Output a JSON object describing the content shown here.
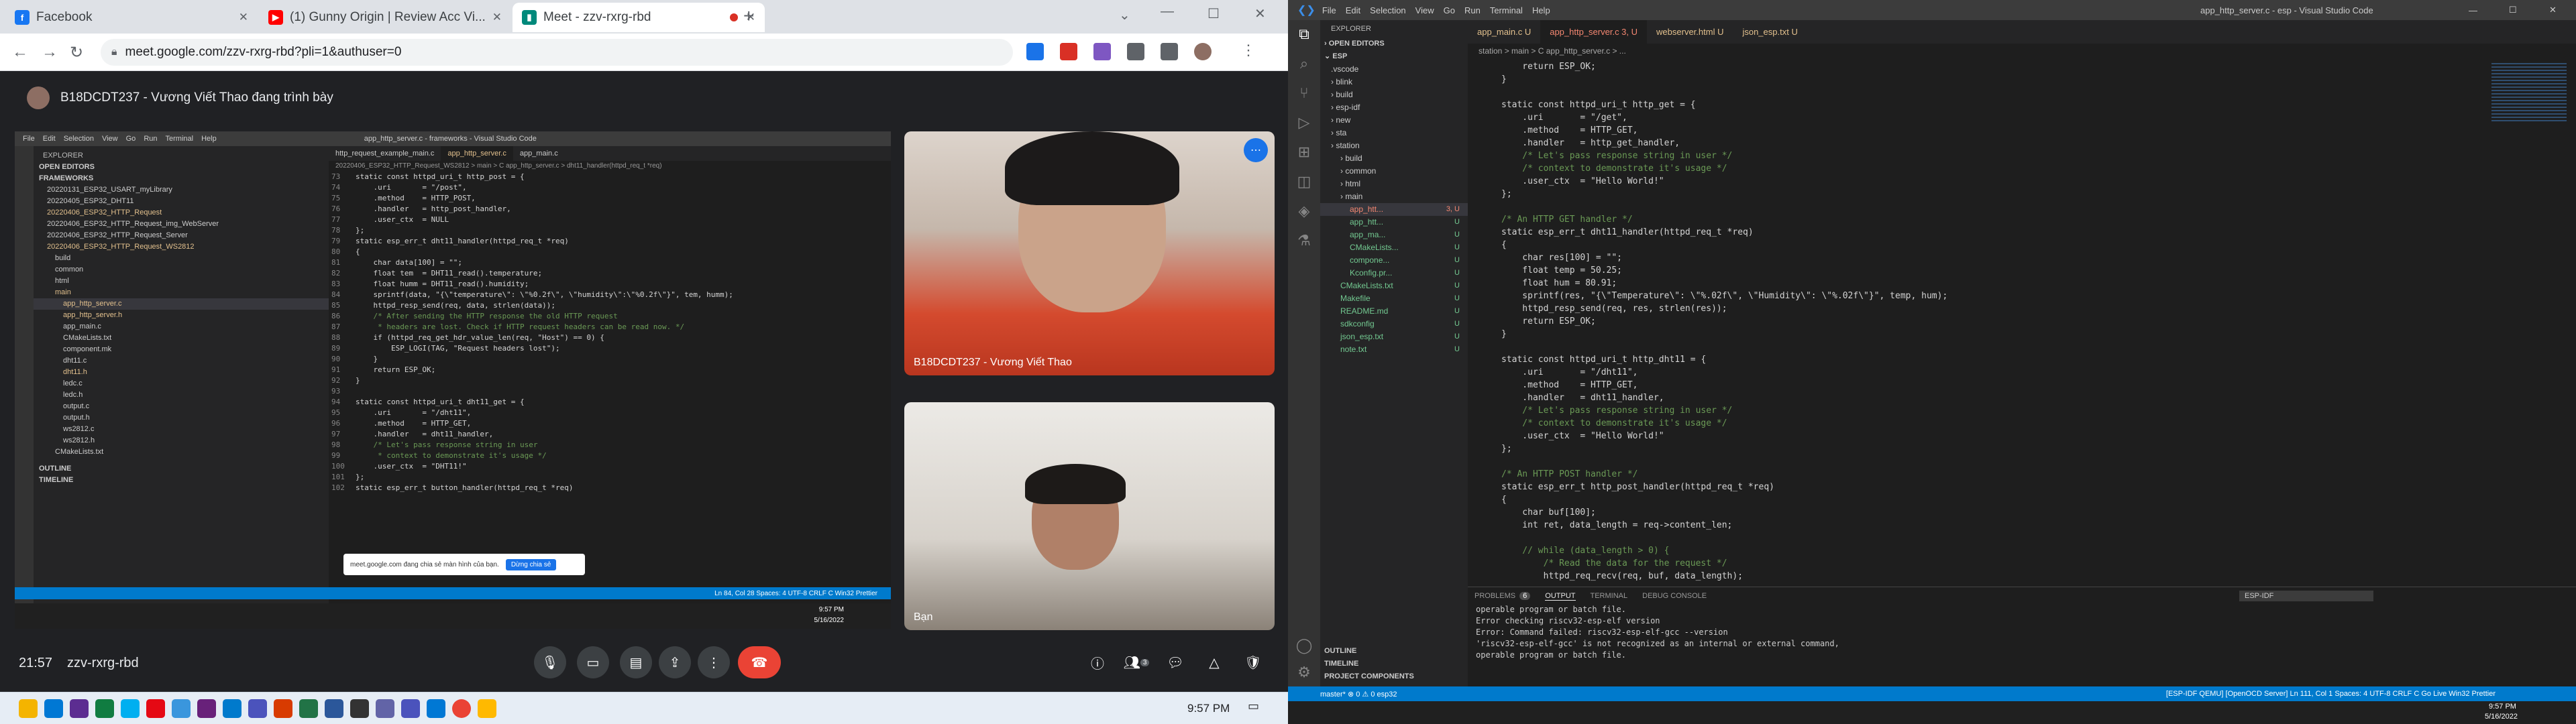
{
  "browser": {
    "tabs": [
      {
        "label": "Facebook",
        "icon": "facebook-icon",
        "color": "#1877f2"
      },
      {
        "label": "(1) Gunny Origin | Review Acc Vi...",
        "icon": "youtube-icon",
        "color": "#ff0000"
      },
      {
        "label": "Meet - zzv-rxrg-rbd",
        "icon": "meet-icon",
        "color": "#00897b"
      }
    ],
    "url": "meet.google.com/zzv-rxrg-rbd?pli=1&authuser=0"
  },
  "meet": {
    "presenter_text": "B18DCDT237 - Vương Viết Thao đang trình bày",
    "participant1": "B18DCDT237 - Vương Viết Thao",
    "participant2": "Bạn",
    "time": "21:57",
    "meeting_code": "zzv-rxrg-rbd",
    "notif_text": "meet.google.com đang chia sẻ màn hình của bạn.",
    "notif_btn": "Dừng chia sẻ",
    "people_count": "3",
    "end_color": "#ea4335"
  },
  "shared": {
    "title": "app_http_server.c - frameworks - Visual Studio Code",
    "menu": [
      "File",
      "Edit",
      "Selection",
      "View",
      "Go",
      "Run",
      "Terminal",
      "Help"
    ],
    "tabs": [
      "http_request_example_main.c",
      "app_http_server.c",
      "app_main.c"
    ],
    "breadcrumb": "20220406_ESP32_HTTP_Request_WS2812 > main > C app_http_server.c > dht11_handler(httpd_req_t *req)",
    "tree": [
      "EXPLORER",
      "OPEN EDITORS",
      "FRAMEWORKS",
      "20220131_ESP32_USART_myLibrary",
      "20220405_ESP32_DHT11",
      "20220406_ESP32_HTTP_Request",
      "20220406_ESP32_HTTP_Request_img_WebServer",
      "20220406_ESP32_HTTP_Request_Server",
      "20220406_ESP32_HTTP_Request_WS2812",
      "build",
      "common",
      "html",
      "main",
      "app_http_server.c",
      "app_http_server.h",
      "app_main.c",
      "CMakeLists.txt",
      "component.mk",
      "dht11.c",
      "dht11.h",
      "ledc.c",
      "ledc.h",
      "output.c",
      "output.h",
      "ws2812.c",
      "ws2812.h",
      "CMakeLists.txt",
      "OUTLINE",
      "TIMELINE"
    ],
    "code": [
      [
        "73",
        "static const httpd_uri_t http_post = {"
      ],
      [
        "74",
        "    .uri       = \"/post\","
      ],
      [
        "75",
        "    .method    = HTTP_POST,"
      ],
      [
        "76",
        "    .handler   = http_post_handler,"
      ],
      [
        "77",
        "    .user_ctx  = NULL"
      ],
      [
        "78",
        "};"
      ],
      [
        "79",
        "static esp_err_t dht11_handler(httpd_req_t *req)"
      ],
      [
        "80",
        "{"
      ],
      [
        "81",
        "    char data[100] = \"\";"
      ],
      [
        "82",
        "    float tem  = DHT11_read().temperature;"
      ],
      [
        "83",
        "    float humm = DHT11_read().humidity;"
      ],
      [
        "84",
        "    sprintf(data, \"{\\\"temperature\\\": \\\"%0.2f\\\", \\\"humidity\\\":\\\"%0.2f\\\"}\", tem, humm);"
      ],
      [
        "85",
        "    httpd_resp_send(req, data, strlen(data));"
      ],
      [
        "86",
        "    /* After sending the HTTP response the old HTTP request"
      ],
      [
        "87",
        "     * headers are lost. Check if HTTP request headers can be read now. */"
      ],
      [
        "88",
        "    if (httpd_req_get_hdr_value_len(req, \"Host\") == 0) {"
      ],
      [
        "89",
        "        ESP_LOGI(TAG, \"Request headers lost\");"
      ],
      [
        "90",
        "    }"
      ],
      [
        "91",
        "    return ESP_OK;"
      ],
      [
        "92",
        "}"
      ],
      [
        "93",
        ""
      ],
      [
        "94",
        "static const httpd_uri_t dht11_get = {"
      ],
      [
        "95",
        "    .uri       = \"/dht11\","
      ],
      [
        "96",
        "    .method    = HTTP_GET,"
      ],
      [
        "97",
        "    .handler   = dht11_handler,"
      ],
      [
        "98",
        "    /* Let's pass response string in user"
      ],
      [
        "99",
        "     * context to demonstrate it's usage */"
      ],
      [
        "100",
        "    .user_ctx  = \"DHT11!\""
      ],
      [
        "101",
        "};"
      ],
      [
        "102",
        "static esp_err_t button_handler(httpd_req_t *req)"
      ]
    ],
    "status": "Ln 84, Col 28   Spaces: 4   UTF-8   CRLF   C   Win32   Prettier",
    "clock": "9:57 PM",
    "date": "5/16/2022"
  },
  "vscode": {
    "title": "app_http_server.c - esp - Visual Studio Code",
    "menu": [
      "File",
      "Edit",
      "Selection",
      "View",
      "Go",
      "Run",
      "Terminal",
      "Help"
    ],
    "tabs": [
      "app_main.c  U",
      "app_http_server.c  3, U",
      "webserver.html  U",
      "json_esp.txt  U"
    ],
    "breadcrumb": "station > main > C app_http_server.c > ...",
    "explorer": {
      "header": "EXPLORER",
      "open_editors": "OPEN EDITORS",
      "root": "ESP",
      "items": [
        {
          "label": ".vscode",
          "mod": ""
        },
        {
          "label": "blink",
          "mod": ""
        },
        {
          "label": "build",
          "mod": ""
        },
        {
          "label": "esp-idf",
          "mod": ""
        },
        {
          "label": "new",
          "mod": ""
        },
        {
          "label": "sta",
          "mod": ""
        },
        {
          "label": "station",
          "mod": ""
        },
        {
          "label": "build",
          "mod": ""
        },
        {
          "label": "common",
          "mod": ""
        },
        {
          "label": "html",
          "mod": ""
        },
        {
          "label": "main",
          "mod": ""
        },
        {
          "label": "app_htt...",
          "mod": "3, U"
        },
        {
          "label": "app_htt...",
          "mod": "U"
        },
        {
          "label": "app_ma...",
          "mod": "U"
        },
        {
          "label": "CMakeLists...",
          "mod": "U"
        },
        {
          "label": "compone...",
          "mod": "U"
        },
        {
          "label": "Kconfig.pr...",
          "mod": "U"
        },
        {
          "label": "CMakeLists.txt",
          "mod": "U"
        },
        {
          "label": "Makefile",
          "mod": "U"
        },
        {
          "label": "README.md",
          "mod": "U"
        },
        {
          "label": "sdkconfig",
          "mod": "U"
        },
        {
          "label": "json_esp.txt",
          "mod": "U"
        },
        {
          "label": "note.txt",
          "mod": "U"
        }
      ],
      "outline": "OUTLINE",
      "timeline": "TIMELINE",
      "project": "PROJECT COMPONENTS"
    },
    "code": [
      "    return ESP_OK;",
      "}",
      "",
      "static const httpd_uri_t http_get = {",
      "    .uri       = \"/get\",",
      "    .method    = HTTP_GET,",
      "    .handler   = http_get_handler,",
      "    /* Let's pass response string in user */",
      "    /* context to demonstrate it's usage */",
      "    .user_ctx  = \"Hello World!\"",
      "};",
      "",
      "/* An HTTP GET handler */",
      "static esp_err_t dht11_handler(httpd_req_t *req)",
      "{",
      "    char res[100] = \"\";",
      "    float temp = 50.25;",
      "    float hum = 80.91;",
      "    sprintf(res, \"{\\\"Temperature\\\": \\\"%.02f\\\", \\\"Humidity\\\": \\\"%.02f\\\"}\", temp, hum);",
      "    httpd_resp_send(req, res, strlen(res));",
      "    return ESP_OK;",
      "}",
      "",
      "static const httpd_uri_t http_dht11 = {",
      "    .uri       = \"/dht11\",",
      "    .method    = HTTP_GET,",
      "    .handler   = dht11_handler,",
      "    /* Let's pass response string in user */",
      "    /* context to demonstrate it's usage */",
      "    .user_ctx  = \"Hello World!\"",
      "};",
      "",
      "/* An HTTP POST handler */",
      "static esp_err_t http_post_handler(httpd_req_t *req)",
      "{",
      "    char buf[100];",
      "    int ret, data_length = req->content_len;",
      "",
      "    // while (data_length > 0) {",
      "        /* Read the data for the request */",
      "        httpd_req_recv(req, buf, data_length);"
    ],
    "panel_tabs": [
      "PROBLEMS",
      "6",
      "OUTPUT",
      "TERMINAL",
      "DEBUG CONSOLE"
    ],
    "panel_dropdown": "ESP-IDF",
    "output": [
      "operable program or batch file.",
      "Error checking riscv32-esp-elf version",
      "Error: Command failed: riscv32-esp-elf-gcc --version",
      "'riscv32-esp-elf-gcc' is not recognized as an internal or external command,",
      "operable program or batch file."
    ],
    "status_left": "master*   ⊗ 0 ⚠ 0   esp32",
    "status_right": "[ESP-IDF QEMU]   [OpenOCD Server]   Ln 111, Col 1   Spaces: 4   UTF-8   CRLF   C   Go Live   Win32   Prettier",
    "clock": "9:57 PM",
    "date": "5/16/2022"
  }
}
